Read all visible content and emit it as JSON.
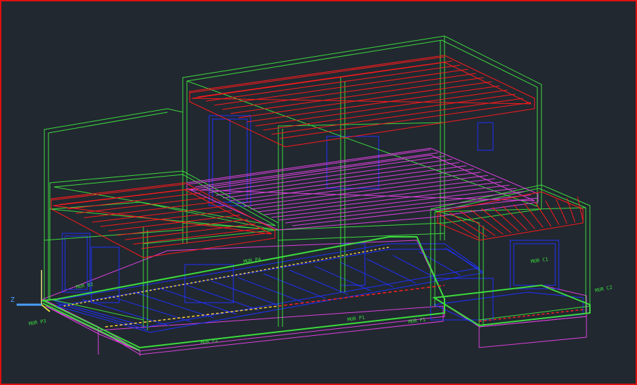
{
  "colors": {
    "background": "#212830",
    "frame": "#e01010",
    "walls": "#3ddc3d",
    "roof_joists": "#ff1a1a",
    "floor_framing": "#e040e0",
    "openings": "#2030ff",
    "labels": "#3ddc3d"
  },
  "axis": {
    "z_label": "Z",
    "icon": "ucs-axis-icon"
  },
  "labels": {
    "mur_b2": "MUR B2",
    "mur_p1": "MUR P1",
    "mur_p2": "MUR P2",
    "mur_p3": "MUR P3",
    "mur_p4": "MUR P4",
    "mur_c1": "MUR C1",
    "mur_c2": "MUR C2",
    "mur_f1": "MUR F1"
  }
}
